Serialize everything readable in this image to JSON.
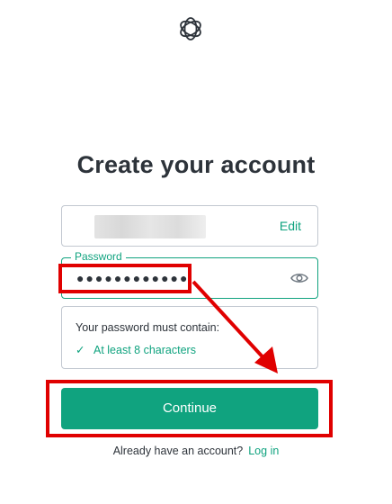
{
  "email": {
    "edit_label": "Edit"
  },
  "page": {
    "title": "Create your account"
  },
  "password": {
    "label": "Password",
    "masked_value": "●●●●●●●●●●●●"
  },
  "requirements": {
    "title": "Your password must contain:",
    "items": [
      {
        "check": "✓",
        "text": "At least 8 characters"
      }
    ]
  },
  "continue_label": "Continue",
  "footer": {
    "prompt": "Already have an account?",
    "login_label": "Log in"
  },
  "colors": {
    "accent": "#10a37f",
    "highlight": "#e00000",
    "text": "#2d333a"
  },
  "icons": [
    "openai-logo-icon",
    "eye-icon",
    "checkmark-icon"
  ]
}
